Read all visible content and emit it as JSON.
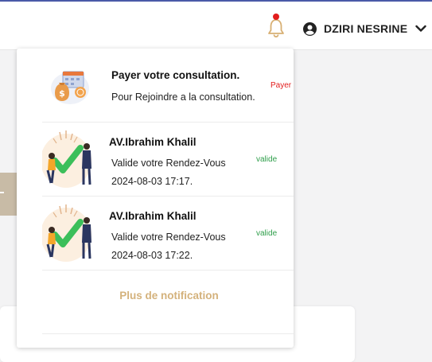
{
  "header": {
    "user_name": "DZIRI NESRINE"
  },
  "notifications": [
    {
      "title": "Payer votre consultation.",
      "line1": "Pour Rejoindre a la consultation.",
      "line2": "",
      "status": "Payer",
      "status_color": "#e21d1d",
      "icon": "payment-icon"
    },
    {
      "title": "AV.Ibrahim Khalil",
      "line1": "Valide votre Rendez-Vous",
      "line2": "2024-08-03 17:17.",
      "status": "valide",
      "status_color": "#2e9e4a",
      "icon": "validation-icon"
    },
    {
      "title": "AV.Ibrahim Khalil",
      "line1": "Valide votre Rendez-Vous",
      "line2": "2024-08-03 17:22.",
      "status": "valide",
      "status_color": "#2e9e4a",
      "icon": "validation-icon"
    }
  ],
  "more_label": "Plus de notification",
  "colors": {
    "accent": "#d4b27c",
    "bell": "#d8b074",
    "badge": "#e21d1d",
    "top_border": "#4a5aa8"
  }
}
